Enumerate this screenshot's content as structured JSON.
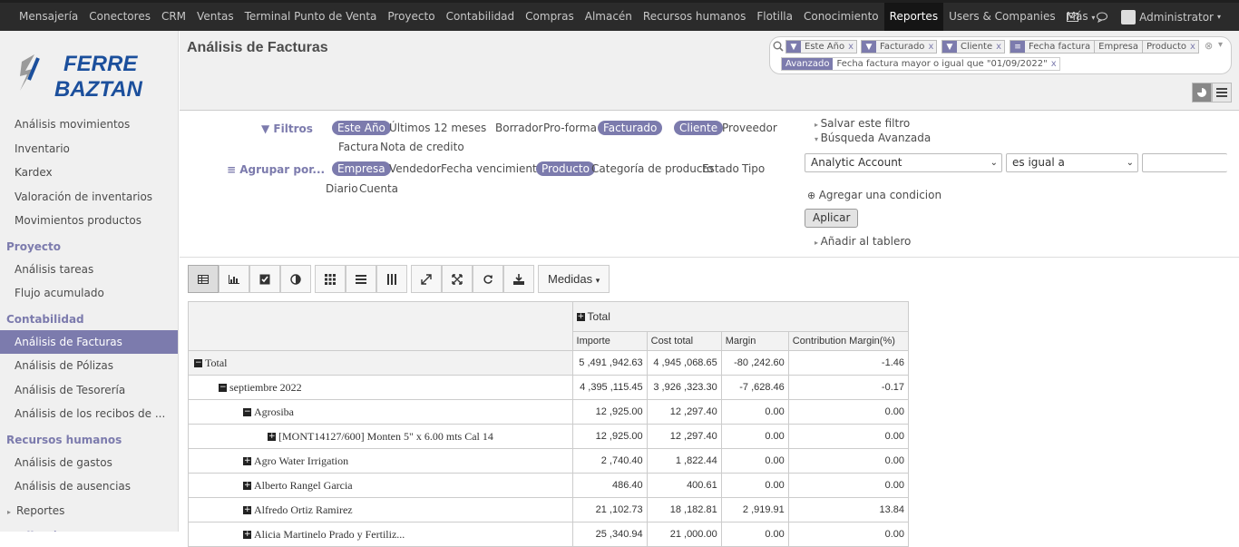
{
  "topbar": {
    "menu": [
      "Mensajería",
      "Conectores",
      "CRM",
      "Ventas",
      "Terminal Punto de Venta",
      "Proyecto",
      "Contabilidad",
      "Compras",
      "Almacén",
      "Recursos humanos",
      "Flotilla",
      "Conocimiento",
      "Reportes",
      "Users & Companies",
      "Más"
    ],
    "active": "Reportes",
    "user": "Administrator"
  },
  "logo": {
    "line1": "FERRE",
    "line2": "BAZTAN"
  },
  "sidebar": {
    "top_items": [
      "Análisis movimientos",
      "Inventario",
      "Kardex",
      "Valoración de inventarios",
      "Movimientos productos"
    ],
    "proyecto": {
      "head": "Proyecto",
      "items": [
        "Análisis tareas",
        "Flujo acumulado"
      ]
    },
    "contabilidad": {
      "head": "Contabilidad",
      "items": [
        "Análisis de Facturas",
        "Análisis de Pólizas",
        "Análisis de Tesorería",
        "Análisis de los recibos de ..."
      ]
    },
    "rrhh": {
      "head": "Recursos humanos",
      "items": [
        "Análisis de gastos",
        "Análisis de ausencias"
      ]
    },
    "reportes": "Reportes",
    "last_head": "Auditoría"
  },
  "header": {
    "title": "Análisis de Facturas"
  },
  "search": {
    "facets": [
      {
        "values": [
          "Este Año"
        ]
      },
      {
        "values": [
          "Facturado"
        ]
      },
      {
        "values": [
          "Cliente"
        ]
      },
      {
        "values": [
          "Fecha factura",
          "Empresa",
          "Producto"
        ]
      }
    ],
    "advanced_label": "Avanzado",
    "advanced_value": "Fecha factura mayor o igual que \"01/09/2022\""
  },
  "filters": {
    "filtros_label": "Filtros",
    "row1": [
      "Este Año",
      "Últimos 12 meses",
      "Borrador",
      "Pro-forma",
      "Facturado",
      "Cliente",
      "Proveedor"
    ],
    "row2": [
      "Factura",
      "Nota de credito"
    ],
    "agrupar_label": "Agrupar por...",
    "group1": [
      "Empresa",
      "Vendedor",
      "Fecha vencimiento",
      "Producto",
      "Categoría de producto",
      "Estado",
      "Tipo"
    ],
    "group2": [
      "Diario",
      "Cuenta"
    ],
    "save_filter": "Salvar este filtro",
    "advanced_search": "Búsqueda Avanzada",
    "field_select": "Analytic Account",
    "op_select": "es igual a",
    "add_condition": "Agregar una condicion",
    "apply": "Aplicar",
    "add_dashboard": "Añadir al tablero"
  },
  "toolbar": {
    "measures": "Medidas"
  },
  "pivot": {
    "col_total": "Total",
    "measures": [
      "Importe",
      "Cost total",
      "Margin",
      "Contribution Margin(%)"
    ],
    "rows": [
      {
        "label": "Total",
        "indent": 0,
        "icon": "minus",
        "values": [
          "5 ,491 ,942.63",
          "4 ,945 ,068.65",
          "-80 ,242.60",
          "-1.46"
        ]
      },
      {
        "label": "septiembre 2022",
        "indent": 1,
        "icon": "minus",
        "values": [
          "4 ,395 ,115.45",
          "3 ,926 ,323.30",
          "-7 ,628.46",
          "-0.17"
        ]
      },
      {
        "label": "Agrosiba",
        "indent": 2,
        "icon": "minus",
        "values": [
          "12 ,925.00",
          "12 ,297.40",
          "0.00",
          "0.00"
        ]
      },
      {
        "label": "[MONT14127/600] Monten 5\" x 6.00 mts Cal 14",
        "indent": 3,
        "icon": "plus",
        "values": [
          "12 ,925.00",
          "12 ,297.40",
          "0.00",
          "0.00"
        ]
      },
      {
        "label": "Agro Water Irrigation",
        "indent": 2,
        "icon": "plus",
        "values": [
          "2 ,740.40",
          "1 ,822.44",
          "0.00",
          "0.00"
        ]
      },
      {
        "label": "Alberto Rangel Garcia",
        "indent": 2,
        "icon": "plus",
        "values": [
          "486.40",
          "400.61",
          "0.00",
          "0.00"
        ]
      },
      {
        "label": "Alfredo Ortiz Ramirez",
        "indent": 2,
        "icon": "plus",
        "values": [
          "21 ,102.73",
          "18 ,182.81",
          "2 ,919.91",
          "13.84"
        ]
      },
      {
        "label": "Alicia Martinelo Prado y Fertiliz...",
        "indent": 2,
        "icon": "plus",
        "values": [
          "25 ,340.94",
          "21 ,000.00",
          "0.00",
          "0.00"
        ]
      }
    ]
  }
}
